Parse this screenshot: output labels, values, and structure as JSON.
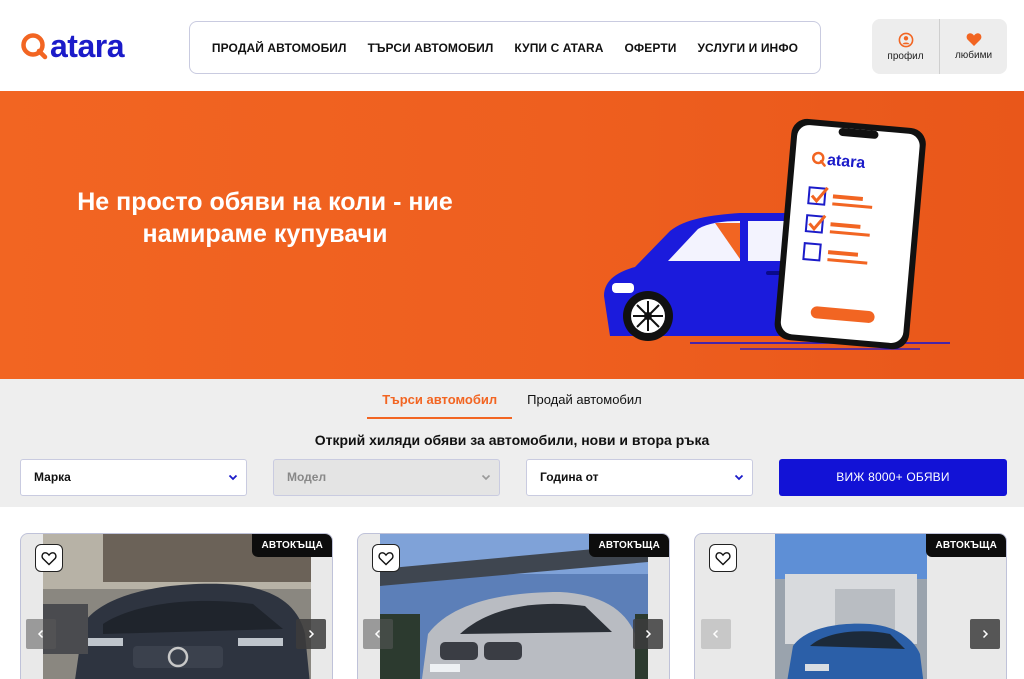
{
  "brand": {
    "name": "atara",
    "accent": "#f26522",
    "primary": "#1b1bc9"
  },
  "nav": {
    "items": [
      "ПРОДАЙ АВТОМОБИЛ",
      "ТЪРСИ АВТОМОБИЛ",
      "КУПИ С ATARA",
      "ОФЕРТИ",
      "УСЛУГИ И ИНФО"
    ]
  },
  "user": {
    "profile_label": "профил",
    "favorites_label": "любими"
  },
  "hero": {
    "line1": "Не просто обяви на коли - ние",
    "line2": "намираме купувачи",
    "phone_logo": "atara"
  },
  "search": {
    "tabs": [
      "Търси автомобил",
      "Продай автомобил"
    ],
    "active_tab": "Търси автомобил",
    "headline": "Открий хиляди обяви за автомобили, нови и втора ръка",
    "make": "Марка",
    "model": "Модел",
    "year": "Година от",
    "cta": "ВИЖ 8000+ ОБЯВИ"
  },
  "cards": [
    {
      "badge": "АВТОКЪЩА"
    },
    {
      "badge": "АВТОКЪЩА"
    },
    {
      "badge": "АВТОКЪЩА"
    }
  ]
}
